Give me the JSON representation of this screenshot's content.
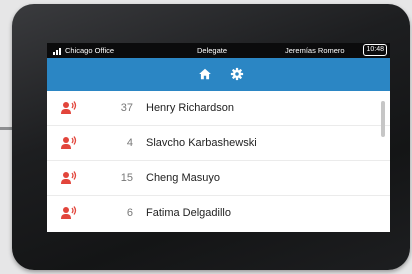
{
  "status_bar": {
    "location": "Chicago Office",
    "mode": "Delegate",
    "user": "Jeremías Romero",
    "time": "10:48"
  },
  "nav": {
    "icons": [
      "home-icon",
      "gear-icon"
    ],
    "bar_color": "#2b86c4"
  },
  "list": {
    "icon": "speaking-person-icon",
    "icon_color": "#e2453b",
    "items": [
      {
        "number": "37",
        "name": "Henry Richardson"
      },
      {
        "number": "4",
        "name": "Slavcho Karbashewski"
      },
      {
        "number": "15",
        "name": "Cheng Masuyo"
      },
      {
        "number": "6",
        "name": "Fatima Delgadillo"
      }
    ]
  }
}
